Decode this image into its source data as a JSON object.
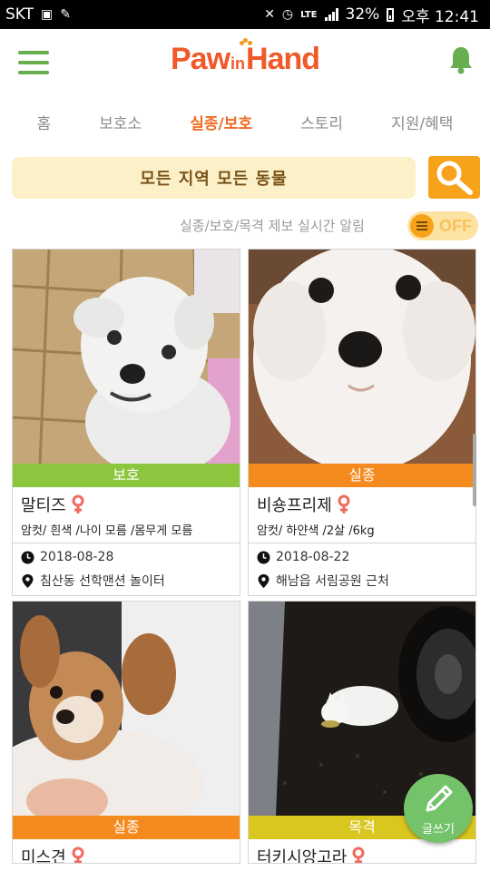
{
  "status_bar": {
    "carrier": "SKT",
    "battery": "32%",
    "time": "오후 12:41",
    "network": "LTE"
  },
  "header": {
    "logo": {
      "part1": "Paw",
      "part2": "in",
      "part3": "Hand"
    },
    "colors": {
      "brand": "#f05a2a",
      "accent_green": "#67ae4f",
      "accent_orange": "#f7a21b"
    }
  },
  "tabs": [
    {
      "label": "홈",
      "active": false
    },
    {
      "label": "보호소",
      "active": false
    },
    {
      "label": "실종/보호",
      "active": true
    },
    {
      "label": "스토리",
      "active": false
    },
    {
      "label": "지원/혜택",
      "active": false
    }
  ],
  "filter": {
    "label": "모든 지역  모든 동물"
  },
  "notify": {
    "label": "실종/보호/목격 제보 실시간 알림",
    "toggle": "OFF"
  },
  "cards": [
    {
      "status": "보호",
      "status_color": "#8cc63e",
      "name": "말티즈",
      "sex": "female",
      "desc": "암컷/ 흰색 /나이 모름 /몸무게 모름",
      "date": "2018-08-28",
      "location": "침산동 선학맨션 놀이터"
    },
    {
      "status": "실종",
      "status_color": "#f58a1f",
      "name": "비숑프리제",
      "sex": "female",
      "desc": "암컷/ 하얀색 /2살 /6kg",
      "date": "2018-08-22",
      "location": "해남읍 서림공원 근처"
    },
    {
      "status": "실종",
      "status_color": "#f58a1f",
      "name": "미스견",
      "sex": "female"
    },
    {
      "status": "목격",
      "status_color": "#d9c61e",
      "name": "터키시앙고라",
      "sex": "female"
    }
  ],
  "fab": {
    "label": "글쓰기"
  },
  "icons": [
    "menu-icon",
    "bell-icon",
    "search-icon",
    "female-icon",
    "clock-icon",
    "location-pin-icon",
    "pencil-icon"
  ]
}
